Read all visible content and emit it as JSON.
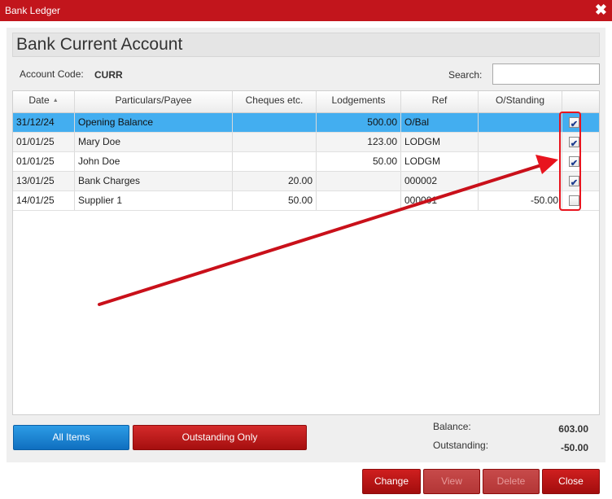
{
  "window": {
    "title": "Bank Ledger"
  },
  "account": {
    "heading": "Bank Current Account",
    "code_label": "Account Code:",
    "code_value": "CURR"
  },
  "search": {
    "label": "Search:",
    "value": "",
    "placeholder": ""
  },
  "table": {
    "columns": [
      "Date",
      "Particulars/Payee",
      "Cheques etc.",
      "Lodgements",
      "Ref",
      "O/Standing"
    ],
    "sort_column": "Date",
    "rows": [
      {
        "date": "31/12/24",
        "payee": "Opening Balance",
        "cheques": "",
        "lodgements": "500.00",
        "ref": "O/Bal",
        "outstanding": "",
        "checked": true,
        "selected": true
      },
      {
        "date": "01/01/25",
        "payee": "Mary Doe",
        "cheques": "",
        "lodgements": "123.00",
        "ref": "LODGM",
        "outstanding": "",
        "checked": true,
        "selected": false
      },
      {
        "date": "01/01/25",
        "payee": "John Doe",
        "cheques": "",
        "lodgements": "50.00",
        "ref": "LODGM",
        "outstanding": "",
        "checked": true,
        "selected": false
      },
      {
        "date": "13/01/25",
        "payee": "Bank Charges",
        "cheques": "20.00",
        "lodgements": "",
        "ref": "000002",
        "outstanding": "",
        "checked": true,
        "selected": false
      },
      {
        "date": "14/01/25",
        "payee": "Supplier 1",
        "cheques": "50.00",
        "lodgements": "",
        "ref": "000001",
        "outstanding": "-50.00",
        "checked": false,
        "selected": false
      }
    ]
  },
  "filters": {
    "all_items": "All Items",
    "outstanding_only": "Outstanding Only"
  },
  "summary": {
    "balance_label": "Balance:",
    "balance_value": "603.00",
    "outstanding_label": "Outstanding:",
    "outstanding_value": "-50.00"
  },
  "footer": {
    "change": "Change",
    "view": "View",
    "delete": "Delete",
    "close": "Close"
  },
  "icons": {
    "close": "close-icon",
    "sort": "sort-ascending-icon",
    "check": "checkmark-icon"
  },
  "colors": {
    "title_bar": "#c2151c",
    "selected_row": "#43aef0",
    "primary_blue": "#1a83d4",
    "button_red": "#b81818",
    "annotation_red": "#e8141e"
  }
}
